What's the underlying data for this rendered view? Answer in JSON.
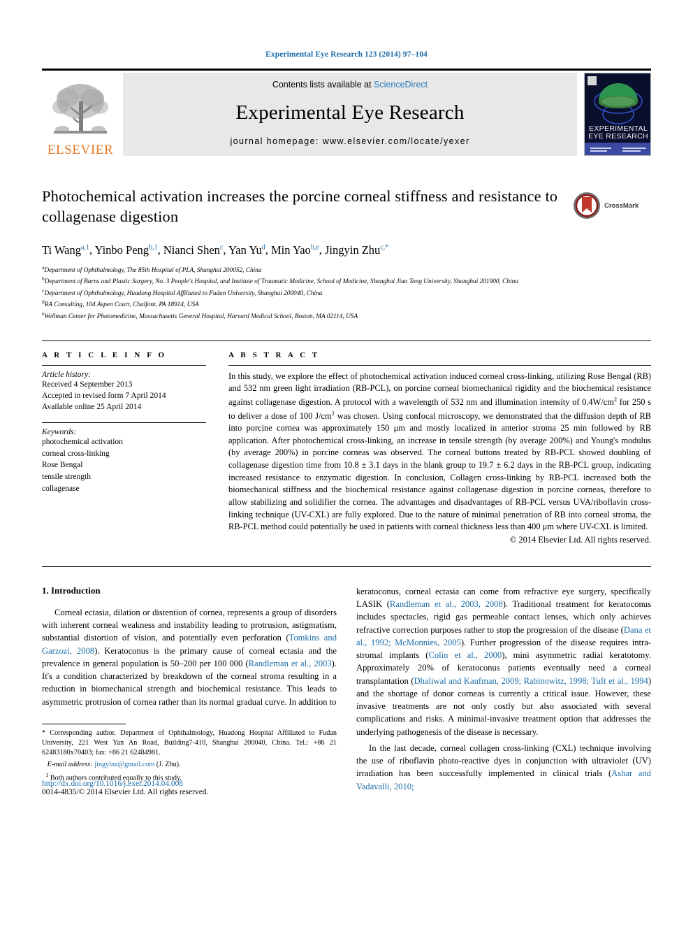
{
  "running_head": "Experimental Eye Research 123 (2014) 97–104",
  "masthead": {
    "publisher_logo_text": "ELSEVIER",
    "contents_prefix": "Contents lists available at ",
    "contents_link": "ScienceDirect",
    "journal_name": "Experimental Eye Research",
    "homepage": "journal homepage: www.elsevier.com/locate/yexer",
    "cover_title_line1": "EXPERIMENTAL",
    "cover_title_line2": "EYE RESEARCH"
  },
  "title": "Photochemical activation increases the porcine corneal stiffness and resistance to collagenase digestion",
  "crossmark_label": "CrossMark",
  "authors": [
    {
      "name": "Ti Wang",
      "sup": "a,1"
    },
    {
      "name": "Yinbo Peng",
      "sup": "b,1"
    },
    {
      "name": "Nianci Shen",
      "sup": "c"
    },
    {
      "name": "Yan Yu",
      "sup": "d"
    },
    {
      "name": "Min Yao",
      "sup": "b,e"
    },
    {
      "name": "Jingyin Zhu",
      "sup": "c,*"
    }
  ],
  "affiliations": [
    {
      "mark": "a",
      "text": "Department of Ophthalmology, The 85th Hospital of PLA, Shanghai 200052, China"
    },
    {
      "mark": "b",
      "text": "Department of Burns and Plastic Surgery, No. 3 People's Hospital, and Institute of Traumatic Medicine, School of Medicine, Shanghai Jiao Tong University, Shanghai 201900, China"
    },
    {
      "mark": "c",
      "text": "Department of Ophthalmology, Huadong Hospital Affiliated to Fudan University, Shanghai 200040, China"
    },
    {
      "mark": "d",
      "text": "RA Consulting, 104 Aspen Court, Chalfont, PA 18914, USA"
    },
    {
      "mark": "e",
      "text": "Wellman Center for Photomedicine, Massachusetts General Hospital, Harvard Medical School, Boston, MA 02114, USA"
    }
  ],
  "article_info": {
    "heading": "A R T I C L E   I N F O",
    "history_label": "Article history:",
    "history": [
      "Received 4 September 2013",
      "Accepted in revised form 7 April 2014",
      "Available online 25 April 2014"
    ],
    "keywords_label": "Keywords:",
    "keywords": [
      "photochemical activation",
      "corneal cross-linking",
      "Rose Bengal",
      "tensile strength",
      "collagenase"
    ]
  },
  "abstract": {
    "heading": "A B S T R A C T",
    "part1": "In this study, we explore the effect of photochemical activation induced corneal cross-linking, utilizing Rose Bengal (RB) and 532 nm green light irradiation (RB-PCL), on porcine corneal biomechanical rigidity and the biochemical resistance against collagenase digestion. A protocol with a wavelength of 532 nm and illumination intensity of 0.4W/cm",
    "sup1": "2",
    "part2": " for 250 s to deliver a dose of 100 J/cm",
    "sup2": "2",
    "part3": " was chosen. Using confocal microscopy, we demonstrated that the diffusion depth of RB into porcine cornea was approximately 150 μm and mostly localized in anterior stroma 25 min followed by RB application. After photochemical cross-linking, an increase in tensile strength (by average 200%) and Young's modulus (by average 200%) in porcine corneas was observed. The corneal buttons treated by RB-PCL showed doubling of collagenase digestion time from 10.8 ± 3.1 days in the blank group to 19.7 ± 6.2 days in the RB-PCL group, indicating increased resistance to enzymatic digestion. In conclusion, Collagen cross-linking by RB-PCL increased both the biomechanical stiffness and the biochemical resistance against collagenase digestion in porcine corneas, therefore to allow stabilizing and solidifier the cornea. The advantages and disadvantages of RB-PCL versus UVA/riboflavin cross-linking technique (UV-CXL) are fully explored. Due to the nature of minimal penetration of RB into corneal stroma, the RB-PCL method could potentially be used in patients with corneal thickness less than 400 μm where UV-CXL is limited.",
    "copyright": "© 2014 Elsevier Ltd. All rights reserved."
  },
  "introduction": {
    "heading": "1. Introduction",
    "left_p1_a": "Corneal ectasia, dilation or distention of cornea, represents a group of disorders with inherent corneal weakness and instability leading to protrusion, astigmatism, substantial distortion of vision, and potentially even perforation (",
    "cite_tomkins": "Tomkins and Garzozi, 2008",
    "left_p1_b": "). Keratoconus is the primary cause of corneal ectasia and the prevalence in general population is 50–200 per 100 000 (",
    "cite_randleman2003": "Randleman et al., 2003",
    "left_p1_c": "). It's a condition characterized by breakdown of the corneal stroma resulting in a reduction in biomechanical strength and biochemical resistance. This leads to asymmetric protrusion of cornea rather than its normal gradual curve. In addition to",
    "right_p1_a": "keratoconus, corneal ectasia can come from refractive eye surgery, specifically LASIK (",
    "cite_randleman2": "Randleman et al., 2003, 2008",
    "right_p1_b": "). Traditional treatment for keratoconus includes spectacles, rigid gas permeable contact lenses, which only achieves refractive correction purposes rather to stop the progression of the disease (",
    "cite_dana": "Dana et al., 1992; McMonnies, 2005",
    "right_p1_c": "). Further progression of the disease requires intra-stromal implants (",
    "cite_colin": "Colin et al., 2000",
    "right_p1_d": "), mini asymmetric radial keratotomy. Approximately 20% of keratoconus patients eventually need a corneal transplantation (",
    "cite_dhaliwal": "Dhaliwal and Kaufman, 2009; Rabinowitz, 1998; Tuft et al., 1994",
    "right_p1_e": ") and the shortage of donor corneas is currently a critical issue. However, these invasive treatments are not only costly but also associated with several complications and risks. A minimal-invasive treatment option that addresses the underlying pathogenesis of the disease is necessary.",
    "right_p2_a": "In the last decade, corneal collagen cross-linking (CXL) technique involving the use of riboflavin photo-reactive dyes in conjunction with ultraviolet (UV) irradiation has been successfully implemented in clinical trials (",
    "cite_ashar": "Ashar and Vadavalli, 2010;"
  },
  "footnotes": {
    "corresponding": "* Corresponding author. Department of Ophthalmology, Huadong Hospital Affiliated to Fudan University, 221 West Yan An Road, Building7-410, Shanghai 200040, China. Tel.: +86 21 62483180x70403; fax: +86 21 62484981.",
    "email_label": "E-mail address:",
    "email": "jingyinz@gmail.com",
    "email_suffix": " (J. Zhu).",
    "equal_mark": "1",
    "equal_contrib": "Both authors contributed equally to this study."
  },
  "bottom": {
    "doi": "http://dx.doi.org/10.1016/j.exer.2014.04.008",
    "issn": "0014-4835/© 2014 Elsevier Ltd. All rights reserved."
  },
  "colors": {
    "link_blue": "#1b6ca8",
    "elsevier_orange": "#e87722",
    "band_gray": "#e8e8e8"
  }
}
